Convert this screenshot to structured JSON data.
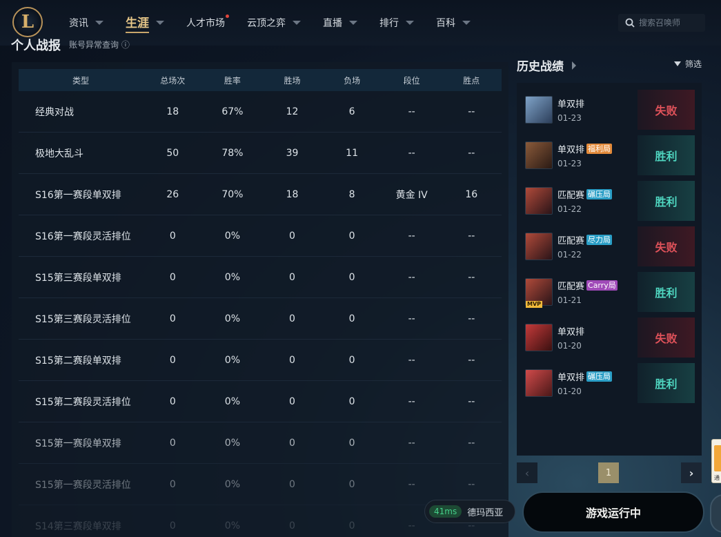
{
  "nav": {
    "logo": "L",
    "items": [
      {
        "label": "资讯",
        "caret": true,
        "active": false,
        "dot": false
      },
      {
        "label": "生涯",
        "caret": true,
        "active": true,
        "dot": false
      },
      {
        "label": "人才市场",
        "caret": false,
        "active": false,
        "dot": true
      },
      {
        "label": "云顶之弈",
        "caret": true,
        "active": false,
        "dot": false
      },
      {
        "label": "直播",
        "caret": true,
        "active": false,
        "dot": false
      },
      {
        "label": "排行",
        "caret": true,
        "active": false,
        "dot": false
      },
      {
        "label": "百科",
        "caret": true,
        "active": false,
        "dot": false
      }
    ],
    "search_placeholder": "搜索召唤师"
  },
  "section": {
    "title": "个人战报",
    "subtitle": "账号异常查询 ⓘ"
  },
  "stats_table": {
    "headers": [
      "类型",
      "总场次",
      "胜率",
      "胜场",
      "负场",
      "段位",
      "胜点"
    ],
    "rows": [
      [
        "经典对战",
        "18",
        "67%",
        "12",
        "6",
        "--",
        "--"
      ],
      [
        "极地大乱斗",
        "50",
        "78%",
        "39",
        "11",
        "--",
        "--"
      ],
      [
        "S16第一赛段单双排",
        "26",
        "70%",
        "18",
        "8",
        "黄金 IV",
        "16"
      ],
      [
        "S16第一赛段灵活排位",
        "0",
        "0%",
        "0",
        "0",
        "--",
        "--"
      ],
      [
        "S15第三赛段单双排",
        "0",
        "0%",
        "0",
        "0",
        "--",
        "--"
      ],
      [
        "S15第三赛段灵活排位",
        "0",
        "0%",
        "0",
        "0",
        "--",
        "--"
      ],
      [
        "S15第二赛段单双排",
        "0",
        "0%",
        "0",
        "0",
        "--",
        "--"
      ],
      [
        "S15第二赛段灵活排位",
        "0",
        "0%",
        "0",
        "0",
        "--",
        "--"
      ],
      [
        "S15第一赛段单双排",
        "0",
        "0%",
        "0",
        "0",
        "--",
        "--"
      ],
      [
        "S15第一赛段灵活排位",
        "0",
        "0%",
        "0",
        "0",
        "--",
        "--"
      ],
      [
        "S14第三赛段单双排",
        "0",
        "0%",
        "0",
        "0",
        "--",
        "--"
      ]
    ]
  },
  "history": {
    "title": "历史战绩",
    "filter_label": "筛选",
    "matches": [
      {
        "mode": "单双排",
        "tag": "",
        "tag_color": "",
        "date": "01-23",
        "result": "失败",
        "win": false,
        "mvp": false,
        "avatar_colors": [
          "#7fa3c8",
          "#2c3e5a"
        ]
      },
      {
        "mode": "单双排",
        "tag": "福利局",
        "tag_color": "#e38a3a",
        "date": "01-23",
        "result": "胜利",
        "win": true,
        "mvp": false,
        "avatar_colors": [
          "#8a5a3a",
          "#2a1a14"
        ]
      },
      {
        "mode": "匹配赛",
        "tag": "碾压局",
        "tag_color": "#2a9ec6",
        "date": "01-22",
        "result": "胜利",
        "win": true,
        "mvp": false,
        "avatar_colors": [
          "#b04a3a",
          "#2a1418"
        ]
      },
      {
        "mode": "匹配赛",
        "tag": "尽力局",
        "tag_color": "#2a9ec6",
        "date": "01-22",
        "result": "失败",
        "win": false,
        "mvp": false,
        "avatar_colors": [
          "#b04a3a",
          "#2a1418"
        ]
      },
      {
        "mode": "匹配赛",
        "tag": "Carry局",
        "tag_color": "#a04ab8",
        "date": "01-21",
        "result": "胜利",
        "win": true,
        "mvp": true,
        "mvp_label": "MVP",
        "avatar_colors": [
          "#b04a3a",
          "#2a1418"
        ]
      },
      {
        "mode": "单双排",
        "tag": "",
        "tag_color": "",
        "date": "01-20",
        "result": "失败",
        "win": false,
        "mvp": false,
        "avatar_colors": [
          "#c43a3a",
          "#3a1010"
        ]
      },
      {
        "mode": "单双排",
        "tag": "碾压局",
        "tag_color": "#2a9ec6",
        "date": "01-20",
        "result": "胜利",
        "win": true,
        "mvp": false,
        "avatar_colors": [
          "#d04a4a",
          "#4a1818"
        ]
      }
    ],
    "pager": {
      "prev": "‹",
      "page": "1",
      "next": "›"
    }
  },
  "status": {
    "latency": "41ms",
    "server": "德玛西亚",
    "game_button": "游戏运行中"
  },
  "side_widget_text": "通"
}
